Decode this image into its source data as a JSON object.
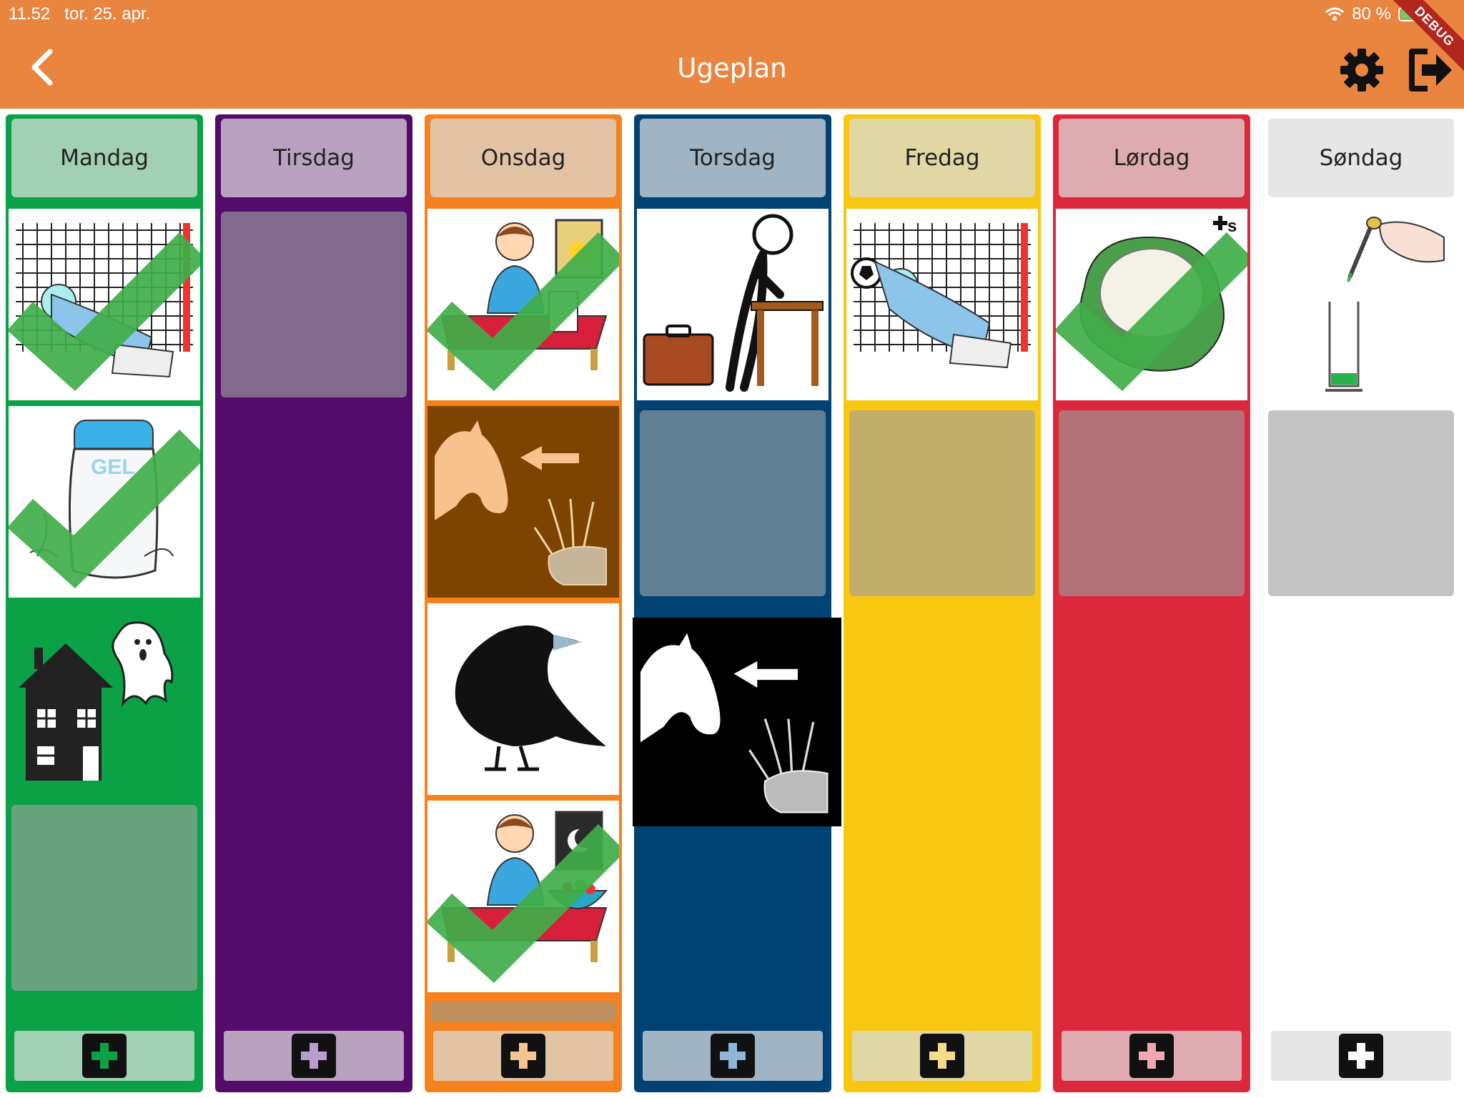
{
  "status_bar": {
    "time": "11.52",
    "date": "tor. 25. apr.",
    "battery": "80 %",
    "wifi_icon": "wifi-icon",
    "battery_icon": "battery-charging-icon"
  },
  "appbar": {
    "title": "Ugeplan",
    "back_icon": "chevron-left-icon",
    "settings_icon": "gear-icon",
    "logout_icon": "logout-icon",
    "debug_banner": "DEBUG",
    "color": "#ea8540"
  },
  "days": [
    {
      "name": "Mandag",
      "color": "#0ba147"
    },
    {
      "name": "Tirsdag",
      "color": "#540b6b"
    },
    {
      "name": "Onsdag",
      "color": "#f5821e"
    },
    {
      "name": "Torsdag",
      "color": "#004274"
    },
    {
      "name": "Fredag",
      "color": "#f7c712"
    },
    {
      "name": "Lørdag",
      "color": "#dc283c"
    },
    {
      "name": "Søndag",
      "color": "#ffffff"
    }
  ],
  "activities": {
    "mandag": [
      {
        "icon": "goalkeeper-icon",
        "done": true
      },
      {
        "icon": "gel-bottle-icon",
        "done": true
      },
      {
        "icon": "haunted-house-ghost-icon",
        "done": false
      }
    ],
    "onsdag": [
      {
        "icon": "child-breakfast-icon",
        "done": true
      },
      {
        "icon": "horse-eats-grain-icon",
        "done": false
      },
      {
        "icon": "raven-icon",
        "done": false
      },
      {
        "icon": "child-dinner-icon",
        "done": true
      }
    ],
    "torsdag": [
      {
        "icon": "person-at-desk-briefcase-icon",
        "done": false
      },
      {
        "icon": "horse-eats-grain-icon",
        "done": false,
        "dragging": true
      }
    ],
    "fredag": [
      {
        "icon": "goalkeeper-icon",
        "done": false
      }
    ],
    "lordag": [
      {
        "icon": "cauliflower-icon",
        "done": true
      }
    ],
    "sondag": [
      {
        "icon": "pipette-measuring-cylinder-icon",
        "done": false
      }
    ]
  },
  "add_button_icon": "plus-icon"
}
